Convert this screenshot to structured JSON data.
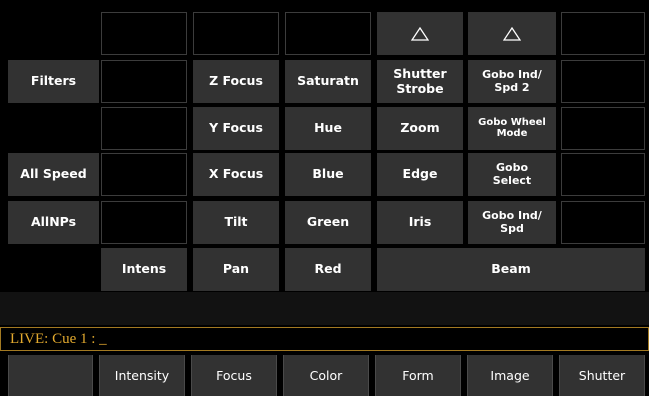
{
  "grid": {
    "row1": {
      "shutter_indicator": "△",
      "gobo_indicator": "△"
    },
    "filters_label": "Filters",
    "all_speed_label": "All Speed",
    "allnps_label": "AllNPs",
    "intens_label": "Intens",
    "focus": {
      "z": "Z Focus",
      "y": "Y Focus",
      "x": "X Focus",
      "tilt": "Tilt",
      "pan": "Pan"
    },
    "color": {
      "saturatn": "Saturatn",
      "hue": "Hue",
      "blue": "Blue",
      "green": "Green",
      "red": "Red"
    },
    "beam": {
      "shutter_strobe": "Shutter\nStrobe",
      "zoom": "Zoom",
      "edge": "Edge",
      "iris": "Iris",
      "gobo_ind_spd2": "Gobo Ind/\nSpd 2",
      "gobo_wheel_mode": "Gobo Wheel\nMode",
      "gobo_select": "Gobo\nSelect",
      "gobo_ind_spd": "Gobo Ind/\nSpd",
      "beam_label": "Beam"
    }
  },
  "command_line": {
    "text": "LIVE: Cue  1 :  _"
  },
  "softkeys": [
    "",
    "Intensity",
    "Focus",
    "Color",
    "Form",
    "Image",
    "Shutter"
  ]
}
